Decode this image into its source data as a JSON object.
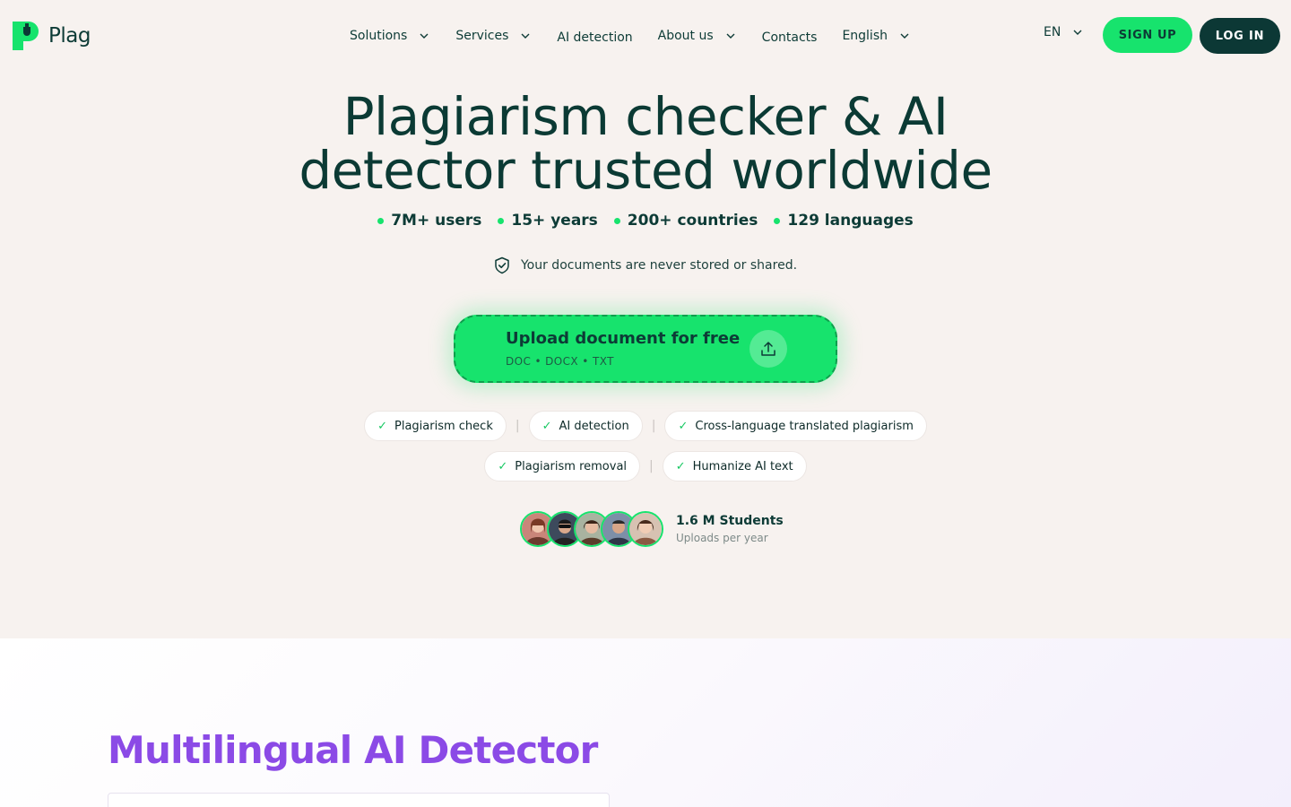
{
  "header": {
    "logo_text": "Plag",
    "nav": [
      {
        "label": "Solutions",
        "dropdown": true
      },
      {
        "label": "Services",
        "dropdown": true
      },
      {
        "label": "AI detection",
        "dropdown": false
      },
      {
        "label": "About us",
        "dropdown": true
      },
      {
        "label": "Contacts",
        "dropdown": false
      },
      {
        "label": "English",
        "dropdown": true
      }
    ],
    "lang_code": "EN",
    "signup_label": "SIGN UP",
    "login_label": "LOG IN"
  },
  "hero": {
    "title_line1": "Plagiarism checker & AI",
    "title_line2": "detector trusted worldwide",
    "stats": [
      "7M+ users",
      "15+ years",
      "200+ countries",
      "129 languages"
    ],
    "secure_text": "Your documents are never stored or shared.",
    "upload_title": "Upload document for free",
    "upload_formats": "DOC • DOCX • TXT",
    "features_row1": [
      "Plagiarism check",
      "AI detection",
      "Cross-language translated plagiarism"
    ],
    "features_row2": [
      "Plagiarism removal",
      "Humanize AI text"
    ],
    "students_count": "1.6 M Students",
    "students_sub": "Uploads per year"
  },
  "section": {
    "title": "Multilingual AI Detector"
  },
  "colors": {
    "brand_green": "#17e36d",
    "dark_teal": "#0c3835",
    "purple": "#8b4ae6",
    "background": "#f7f2ef"
  }
}
